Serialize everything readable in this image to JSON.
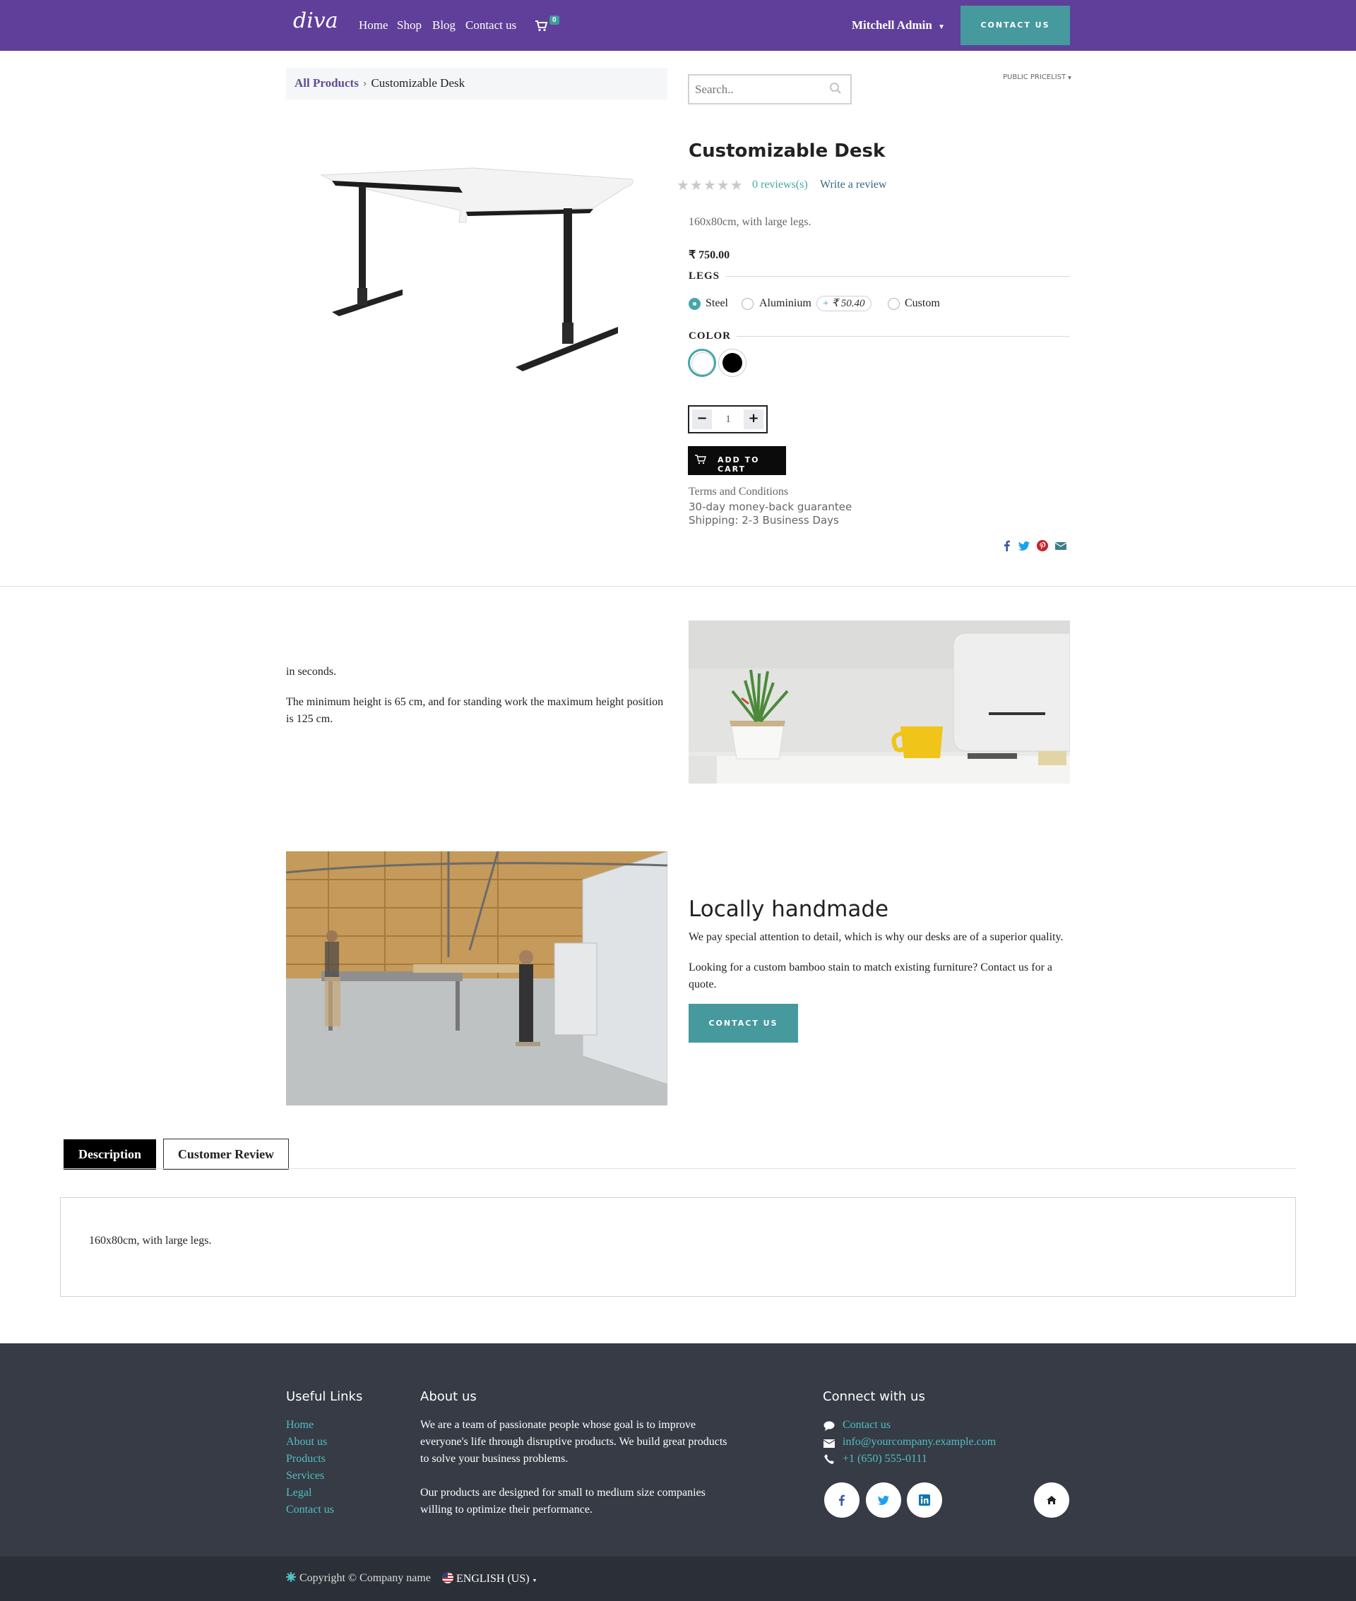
{
  "header": {
    "logo": "diva",
    "nav": [
      "Home",
      "Shop",
      "Blog",
      "Contact us"
    ],
    "cart_count": "0",
    "user": "Mitchell Admin",
    "contact_button": "CONTACT US"
  },
  "breadcrumb": {
    "all": "All Products",
    "separator": "›",
    "current": "Customizable Desk"
  },
  "search": {
    "placeholder": "Search.."
  },
  "pricelist": "PUBLIC PRICELIST",
  "product": {
    "title": "Customizable Desk",
    "stars": "★★★★★",
    "rating": 0,
    "reviews": "0 reviews(s)",
    "write_review": "Write a review",
    "short_description": "160x80cm, with large legs.",
    "price": "₹ 750.00",
    "legs_label": "LEGS",
    "legs_options": [
      "Steel",
      "Aluminium",
      "Custom"
    ],
    "legs_selected": "Steel",
    "aluminium_extra_sign": "+",
    "aluminium_extra": "₹ 50.40",
    "color_label": "COLOR",
    "colors": [
      "#ffffff",
      "#000000"
    ],
    "quantity": "1",
    "qty_minus": "−",
    "qty_plus": "+",
    "add_to_cart": "ADD TO CART",
    "terms": "Terms and Conditions",
    "guarantee": "30-day money-back guarantee",
    "shipping": "Shipping: 2-3 Business Days"
  },
  "content": {
    "text1": "in seconds.",
    "text2": "The minimum height is 65 cm, and for standing work the maximum height position is 125 cm.",
    "handmade_title": "Locally handmade",
    "handmade_p1": "We pay special attention to detail, which is why our desks are of a superior quality.",
    "handmade_p2": "Looking for a custom bamboo stain to match existing furniture? Contact us for a quote.",
    "handmade_button": "CONTACT US"
  },
  "tabs": {
    "description": "Description",
    "review": "Customer Review",
    "panel_text": "160x80cm, with large legs."
  },
  "footer": {
    "useful_links_title": "Useful Links",
    "useful_links": [
      "Home",
      "About us",
      "Products",
      "Services",
      "Legal",
      "Contact us"
    ],
    "about_title": "About us",
    "about_p1": "We are a team of passionate people whose goal is to improve everyone's life through disruptive products. We build great products to solve your business problems.",
    "about_p2": "Our products are designed for small to medium size companies willing to optimize their performance.",
    "connect_title": "Connect with us",
    "contact_link": "Contact us",
    "email": "info@yourcompany.example.com",
    "phone": "+1 (650) 555-0111",
    "copyright": "Copyright © Company name",
    "language": "ENGLISH (US)"
  },
  "colors": {
    "brand": "#5f3f99",
    "accent": "#46999d",
    "footer_bg": "#363b45"
  }
}
